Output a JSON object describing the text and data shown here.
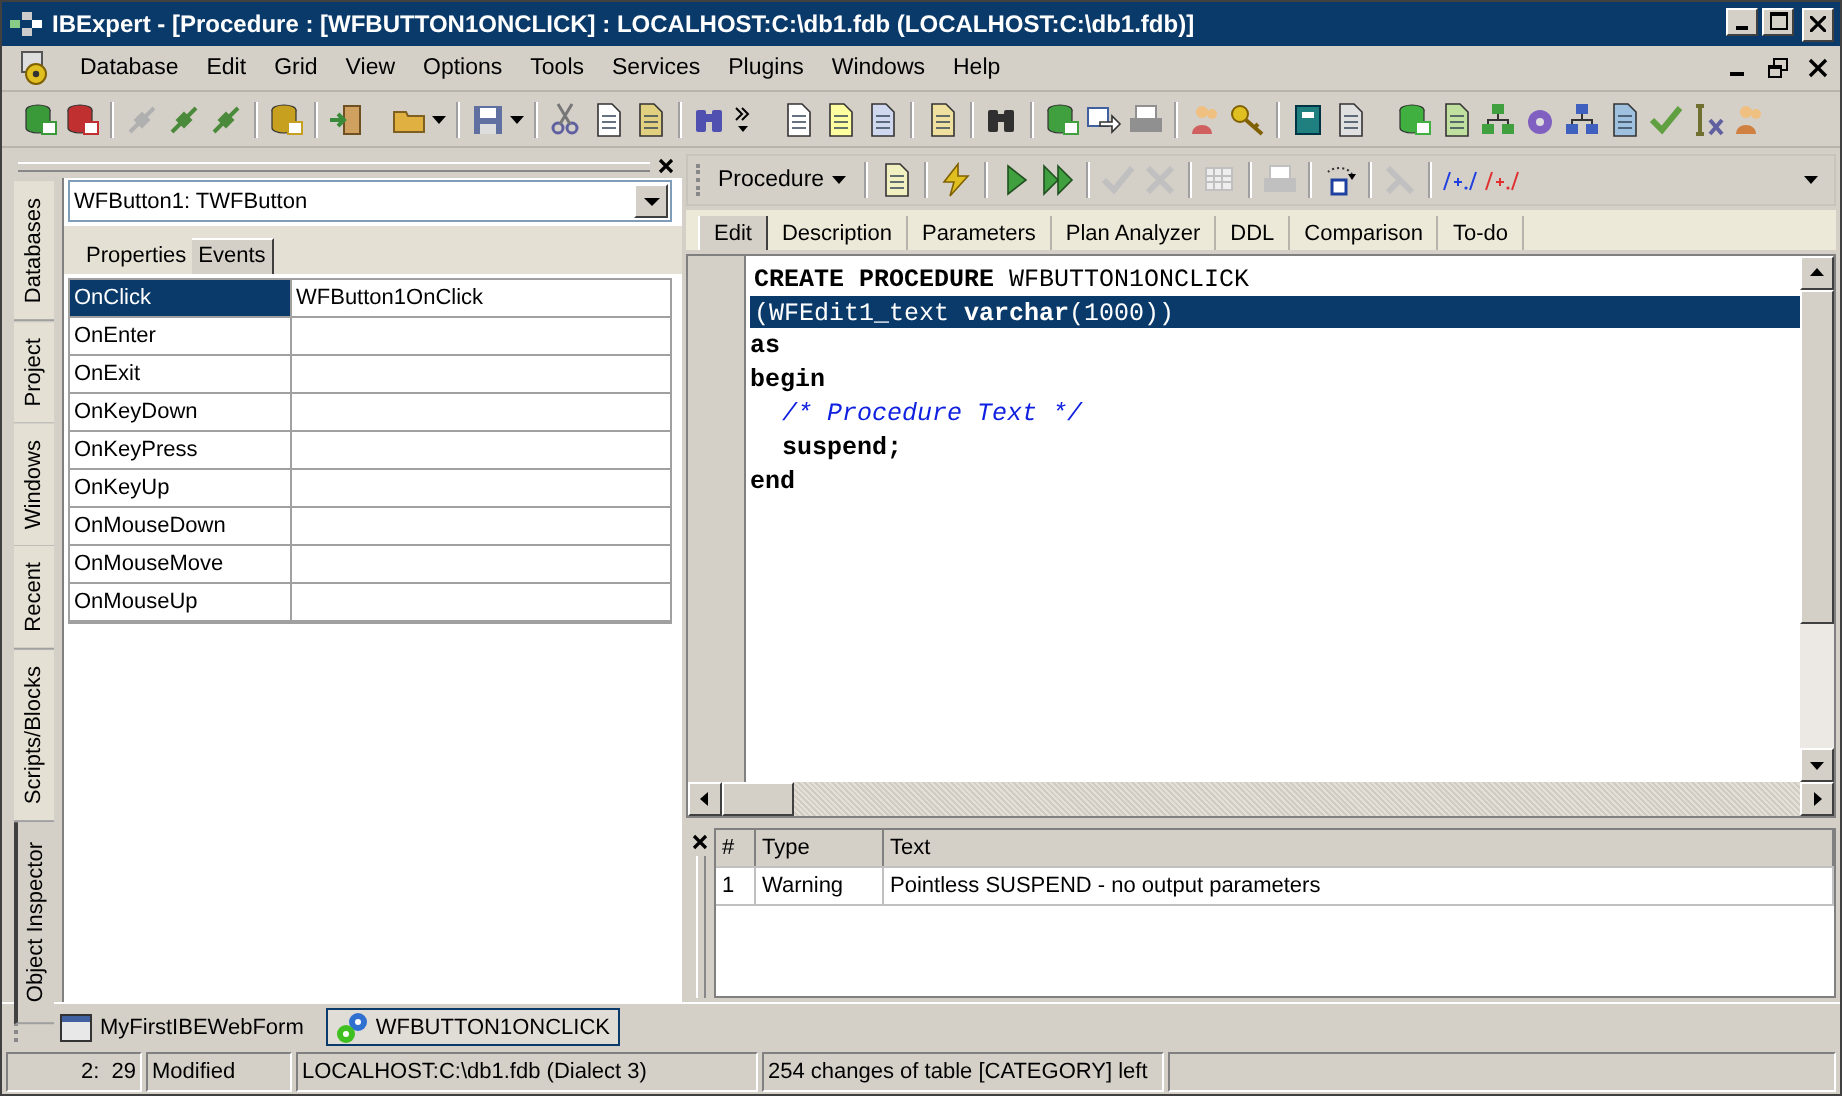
{
  "window": {
    "title": "IBExpert - [Procedure : [WFBUTTON1ONCLICK] : LOCALHOST:C:\\db1.fdb (LOCALHOST:C:\\db1.fdb)]"
  },
  "menu": [
    "Database",
    "Edit",
    "Grid",
    "View",
    "Options",
    "Tools",
    "Services",
    "Plugins",
    "Windows",
    "Help"
  ],
  "side_tabs": [
    {
      "label": "Databases",
      "selected": false
    },
    {
      "label": "Project",
      "selected": false
    },
    {
      "label": "Windows",
      "selected": false
    },
    {
      "label": "Recent",
      "selected": false
    },
    {
      "label": "Scripts/Blocks",
      "selected": false
    },
    {
      "label": "Object Inspector",
      "selected": true
    }
  ],
  "inspector": {
    "object": "WFButton1: TWFButton",
    "tabs": [
      {
        "label": "Properties",
        "selected": false
      },
      {
        "label": "Events",
        "selected": true
      }
    ],
    "rows": [
      {
        "name": "OnClick",
        "value": "WFButton1OnClick",
        "selected": true
      },
      {
        "name": "OnEnter",
        "selected": false
      },
      {
        "name": "OnExit",
        "selected": false
      },
      {
        "name": "OnKeyDown",
        "selected": false
      },
      {
        "name": "OnKeyPress",
        "selected": false
      },
      {
        "name": "OnKeyUp",
        "selected": false
      },
      {
        "name": "OnMouseDown",
        "selected": false
      },
      {
        "name": "OnMouseMove",
        "selected": false
      },
      {
        "name": "OnMouseUp",
        "selected": false
      }
    ]
  },
  "editor_toolbar": {
    "dropdown": "Procedure"
  },
  "editor_tabs": [
    {
      "label": "Edit",
      "selected": true
    },
    {
      "label": "Description",
      "selected": false
    },
    {
      "label": "Parameters",
      "selected": false
    },
    {
      "label": "Plan Analyzer",
      "selected": false
    },
    {
      "label": "DDL",
      "selected": false
    },
    {
      "label": "Comparison",
      "selected": false
    },
    {
      "label": "To-do",
      "selected": false
    }
  ],
  "code": [
    {
      "text": "**CREATE PROCEDURE** WFBUTTON1ONCLICK",
      "kind": "code",
      "indent": false,
      "selected": false
    },
    {
      "text": "(WFEdit1_text **varchar**(1000))",
      "kind": "code",
      "indent": false,
      "selected": true
    },
    {
      "text": "as",
      "kind": "keyword",
      "indent": false,
      "selected": false
    },
    {
      "text": "begin",
      "kind": "keyword",
      "indent": false,
      "selected": false
    },
    {
      "text": "/* Procedure Text */",
      "kind": "comment",
      "indent": true,
      "selected": false
    },
    {
      "text": "suspend;",
      "kind": "keyword",
      "indent": true,
      "selected": false
    },
    {
      "text": "end",
      "kind": "keyword",
      "indent": false,
      "selected": false
    }
  ],
  "messages": {
    "columns": [
      "#",
      "Type",
      "Text"
    ],
    "rows": [
      [
        "1",
        "Warning",
        "Pointless SUSPEND - no output parameters"
      ]
    ]
  },
  "taskbar": [
    {
      "label": "MyFirstIBEWebForm",
      "kind": "form",
      "selected": false
    },
    {
      "label": "WFBUTTON1ONCLICK",
      "kind": "procedure",
      "selected": true
    }
  ],
  "status_bar": [
    "2:  29",
    "Modified",
    "LOCALHOST:C:\\db1.fdb (Dialect 3)",
    "254 changes of table [CATEGORY] left"
  ]
}
